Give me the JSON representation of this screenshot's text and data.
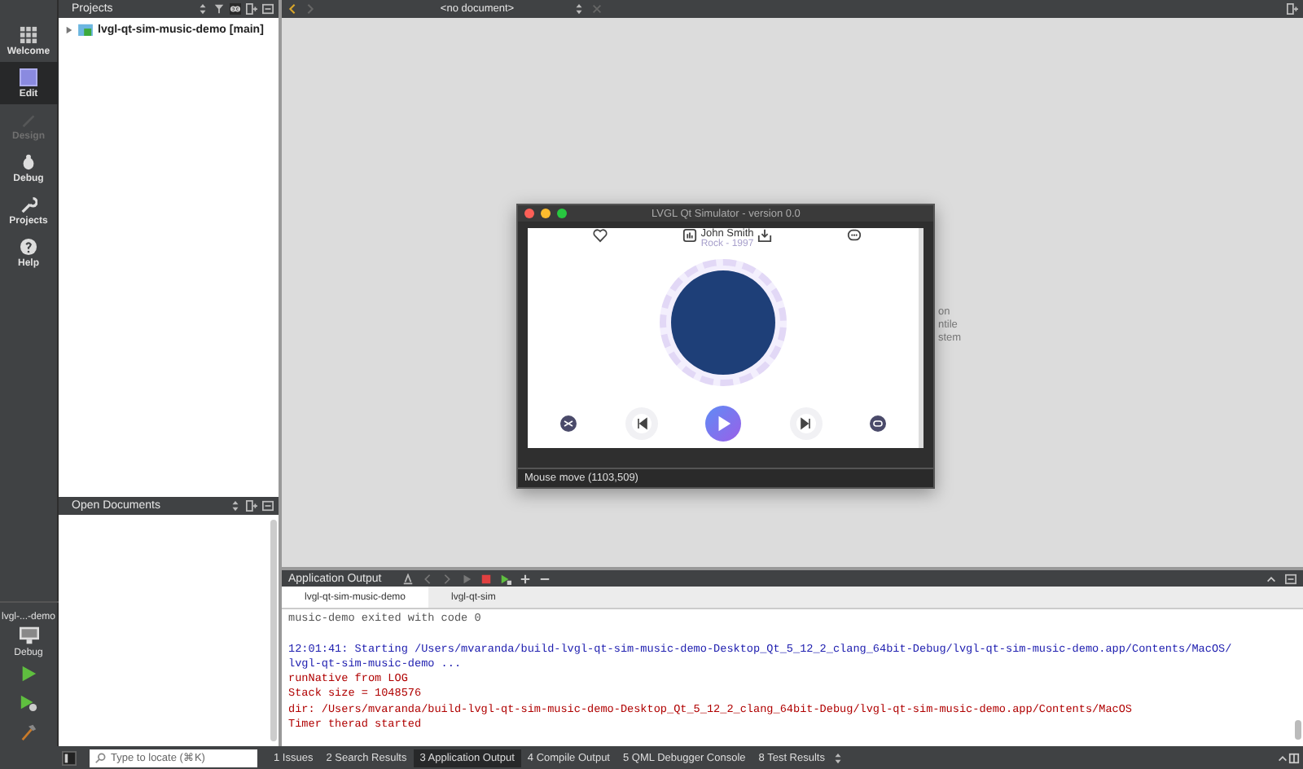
{
  "mode_bar": {
    "modes": [
      {
        "label": "Welcome",
        "kind": "grid",
        "selected": false,
        "disabled": false
      },
      {
        "label": "Edit",
        "kind": "edit",
        "selected": true,
        "disabled": false
      },
      {
        "label": "Design",
        "kind": "pencil",
        "selected": false,
        "disabled": true
      },
      {
        "label": "Debug",
        "kind": "bug",
        "selected": false,
        "disabled": false
      },
      {
        "label": "Projects",
        "kind": "wrench",
        "selected": false,
        "disabled": false
      },
      {
        "label": "Help",
        "kind": "help",
        "selected": false,
        "disabled": false
      }
    ],
    "kit": {
      "project": "lvgl-...-demo",
      "build": "Debug"
    }
  },
  "projects_pane": {
    "title": "Projects",
    "tree": [
      {
        "label": "lvgl-qt-sim-music-demo [main]",
        "expanded": false
      }
    ]
  },
  "open_documents": {
    "title": "Open Documents"
  },
  "editor": {
    "document": "<no document>",
    "background_text": [
      "on",
      "ntile",
      "stem"
    ]
  },
  "simulator": {
    "title": "LVGL Qt Simulator - version 0.0",
    "artist": "John Smith",
    "genre": "Rock - 1997",
    "status": "Mouse move (1103,509)"
  },
  "output_pane": {
    "title": "Application Output",
    "tabs": [
      {
        "label": "lvgl-qt-sim-music-demo",
        "selected": true
      },
      {
        "label": "lvgl-qt-sim",
        "selected": false
      }
    ],
    "lines": [
      {
        "kind": "plain",
        "text": "music-demo exited with code 0"
      },
      {
        "kind": "blank"
      },
      {
        "kind": "info",
        "text": "12:01:41: Starting /Users/mvaranda/build-lvgl-qt-sim-music-demo-Desktop_Qt_5_12_2_clang_64bit-Debug/lvgl-qt-sim-music-demo.app/Contents/MacOS/"
      },
      {
        "kind": "info",
        "text": "lvgl-qt-sim-music-demo ..."
      },
      {
        "kind": "error",
        "text": "runNative from LOG"
      },
      {
        "kind": "error",
        "text": "Stack size = 1048576"
      },
      {
        "kind": "error",
        "text": "dir: /Users/mvaranda/build-lvgl-qt-sim-music-demo-Desktop_Qt_5_12_2_clang_64bit-Debug/lvgl-qt-sim-music-demo.app/Contents/MacOS"
      },
      {
        "kind": "error",
        "text": "Timer therad started"
      }
    ]
  },
  "status_bar": {
    "locate_placeholder": "Type to locate (⌘K)",
    "tabs": [
      {
        "label": "1 Issues",
        "selected": false
      },
      {
        "label": "2 Search Results",
        "selected": false
      },
      {
        "label": "3 Application Output",
        "selected": true
      },
      {
        "label": "4 Compile Output",
        "selected": false
      },
      {
        "label": "5 QML Debugger Console",
        "selected": false
      },
      {
        "label": "8 Test Results",
        "selected": false
      }
    ]
  }
}
